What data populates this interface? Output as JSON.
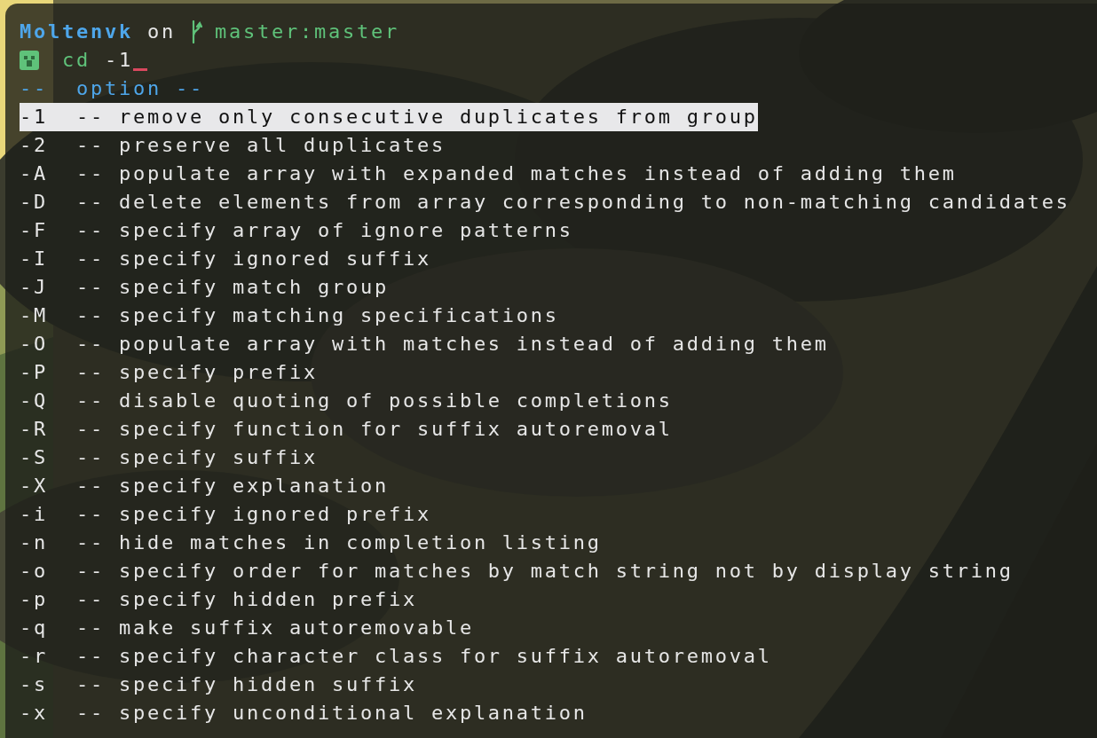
{
  "prompt": {
    "directory": "Moltenvk",
    "connector": "on",
    "branch": "master:master"
  },
  "command_line": {
    "command": "cd",
    "argument": "-1"
  },
  "completion_header": "--  option --",
  "options": [
    {
      "flag": "-1",
      "separator": "--",
      "description": "remove only consecutive duplicates from group",
      "selected": true
    },
    {
      "flag": "-2",
      "separator": "--",
      "description": "preserve all duplicates",
      "selected": false
    },
    {
      "flag": "-A",
      "separator": "--",
      "description": "populate array with expanded matches instead of adding them",
      "selected": false
    },
    {
      "flag": "-D",
      "separator": "--",
      "description": "delete elements from array corresponding to non-matching candidates",
      "selected": false
    },
    {
      "flag": "-F",
      "separator": "--",
      "description": "specify array of ignore patterns",
      "selected": false
    },
    {
      "flag": "-I",
      "separator": "--",
      "description": "specify ignored suffix",
      "selected": false
    },
    {
      "flag": "-J",
      "separator": "--",
      "description": "specify match group",
      "selected": false
    },
    {
      "flag": "-M",
      "separator": "--",
      "description": "specify matching specifications",
      "selected": false
    },
    {
      "flag": "-O",
      "separator": "--",
      "description": "populate array with matches instead of adding them",
      "selected": false
    },
    {
      "flag": "-P",
      "separator": "--",
      "description": "specify prefix",
      "selected": false
    },
    {
      "flag": "-Q",
      "separator": "--",
      "description": "disable quoting of possible completions",
      "selected": false
    },
    {
      "flag": "-R",
      "separator": "--",
      "description": "specify function for suffix autoremoval",
      "selected": false
    },
    {
      "flag": "-S",
      "separator": "--",
      "description": "specify suffix",
      "selected": false
    },
    {
      "flag": "-X",
      "separator": "--",
      "description": "specify explanation",
      "selected": false
    },
    {
      "flag": "-i",
      "separator": "--",
      "description": "specify ignored prefix",
      "selected": false
    },
    {
      "flag": "-n",
      "separator": "--",
      "description": "hide matches in completion listing",
      "selected": false
    },
    {
      "flag": "-o",
      "separator": "--",
      "description": "specify order for matches by match string not by display string",
      "selected": false
    },
    {
      "flag": "-p",
      "separator": "--",
      "description": "specify hidden prefix",
      "selected": false
    },
    {
      "flag": "-q",
      "separator": "--",
      "description": "make suffix autoremovable",
      "selected": false
    },
    {
      "flag": "-r",
      "separator": "--",
      "description": "specify character class for suffix autoremoval",
      "selected": false
    },
    {
      "flag": "-s",
      "separator": "--",
      "description": "specify hidden suffix",
      "selected": false
    },
    {
      "flag": "-x",
      "separator": "--",
      "description": "specify unconditional explanation",
      "selected": false
    }
  ]
}
